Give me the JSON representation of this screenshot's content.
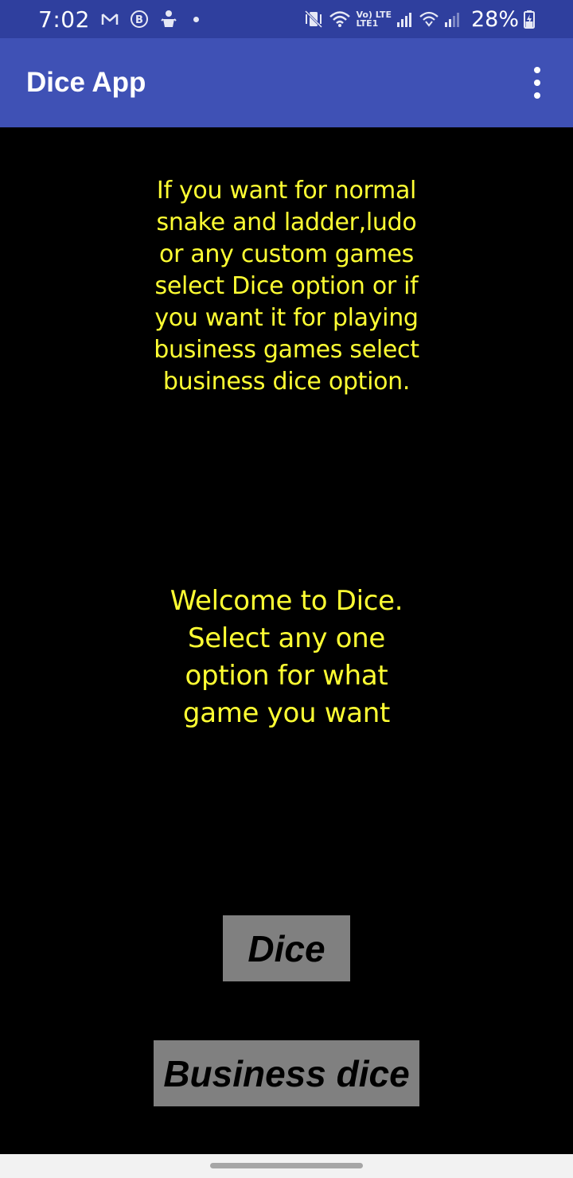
{
  "status_bar": {
    "time": "7:02",
    "notification_icons": [
      "gmail-icon",
      "b-circle-icon",
      "robot-icon",
      "dot-icon"
    ],
    "lte_top": "Vo) LTE",
    "lte_bottom": "LTE1",
    "battery_percent": "28%"
  },
  "app_bar": {
    "title": "Dice App",
    "menu_icon": "overflow-menu-icon"
  },
  "content": {
    "info_text": "If you want for normal snake and ladder,ludo or any custom games select Dice option or if you want it for playing business games select business dice option.",
    "welcome_text": "Welcome to Dice. Select any one option for what game you want"
  },
  "buttons": {
    "dice_label": "Dice",
    "business_dice_label": "Business dice"
  },
  "colors": {
    "status_bar": "#2f3f9e",
    "app_bar": "#3f51b5",
    "background": "#000000",
    "text_yellow": "#ffff33",
    "button_gray": "#808080"
  }
}
